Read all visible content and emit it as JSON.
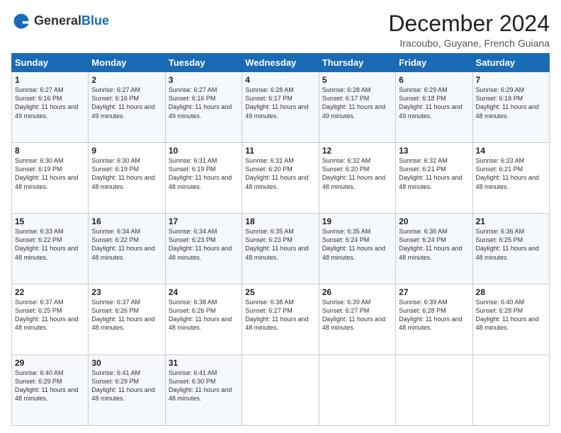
{
  "logo": {
    "general": "General",
    "blue": "Blue"
  },
  "title": "December 2024",
  "subtitle": "Iracoubo, Guyane, French Guiana",
  "days_header": [
    "Sunday",
    "Monday",
    "Tuesday",
    "Wednesday",
    "Thursday",
    "Friday",
    "Saturday"
  ],
  "weeks": [
    [
      {
        "day": "1",
        "sunrise": "6:27 AM",
        "sunset": "6:16 PM",
        "daylight": "11 hours and 49 minutes."
      },
      {
        "day": "2",
        "sunrise": "6:27 AM",
        "sunset": "6:16 PM",
        "daylight": "11 hours and 49 minutes."
      },
      {
        "day": "3",
        "sunrise": "6:27 AM",
        "sunset": "6:16 PM",
        "daylight": "11 hours and 49 minutes."
      },
      {
        "day": "4",
        "sunrise": "6:28 AM",
        "sunset": "6:17 PM",
        "daylight": "11 hours and 49 minutes."
      },
      {
        "day": "5",
        "sunrise": "6:28 AM",
        "sunset": "6:17 PM",
        "daylight": "11 hours and 49 minutes."
      },
      {
        "day": "6",
        "sunrise": "6:29 AM",
        "sunset": "6:18 PM",
        "daylight": "11 hours and 49 minutes."
      },
      {
        "day": "7",
        "sunrise": "6:29 AM",
        "sunset": "6:18 PM",
        "daylight": "11 hours and 48 minutes."
      }
    ],
    [
      {
        "day": "8",
        "sunrise": "6:30 AM",
        "sunset": "6:19 PM",
        "daylight": "11 hours and 48 minutes."
      },
      {
        "day": "9",
        "sunrise": "6:30 AM",
        "sunset": "6:19 PM",
        "daylight": "11 hours and 48 minutes."
      },
      {
        "day": "10",
        "sunrise": "6:31 AM",
        "sunset": "6:19 PM",
        "daylight": "11 hours and 48 minutes."
      },
      {
        "day": "11",
        "sunrise": "6:31 AM",
        "sunset": "6:20 PM",
        "daylight": "11 hours and 48 minutes."
      },
      {
        "day": "12",
        "sunrise": "6:32 AM",
        "sunset": "6:20 PM",
        "daylight": "11 hours and 48 minutes."
      },
      {
        "day": "13",
        "sunrise": "6:32 AM",
        "sunset": "6:21 PM",
        "daylight": "11 hours and 48 minutes."
      },
      {
        "day": "14",
        "sunrise": "6:33 AM",
        "sunset": "6:21 PM",
        "daylight": "11 hours and 48 minutes."
      }
    ],
    [
      {
        "day": "15",
        "sunrise": "6:33 AM",
        "sunset": "6:22 PM",
        "daylight": "11 hours and 48 minutes."
      },
      {
        "day": "16",
        "sunrise": "6:34 AM",
        "sunset": "6:22 PM",
        "daylight": "11 hours and 48 minutes."
      },
      {
        "day": "17",
        "sunrise": "6:34 AM",
        "sunset": "6:23 PM",
        "daylight": "11 hours and 48 minutes."
      },
      {
        "day": "18",
        "sunrise": "6:35 AM",
        "sunset": "6:23 PM",
        "daylight": "11 hours and 48 minutes."
      },
      {
        "day": "19",
        "sunrise": "6:35 AM",
        "sunset": "6:24 PM",
        "daylight": "11 hours and 48 minutes."
      },
      {
        "day": "20",
        "sunrise": "6:36 AM",
        "sunset": "6:24 PM",
        "daylight": "11 hours and 48 minutes."
      },
      {
        "day": "21",
        "sunrise": "6:36 AM",
        "sunset": "6:25 PM",
        "daylight": "11 hours and 48 minutes."
      }
    ],
    [
      {
        "day": "22",
        "sunrise": "6:37 AM",
        "sunset": "6:25 PM",
        "daylight": "11 hours and 48 minutes."
      },
      {
        "day": "23",
        "sunrise": "6:37 AM",
        "sunset": "6:26 PM",
        "daylight": "11 hours and 48 minutes."
      },
      {
        "day": "24",
        "sunrise": "6:38 AM",
        "sunset": "6:26 PM",
        "daylight": "11 hours and 48 minutes."
      },
      {
        "day": "25",
        "sunrise": "6:38 AM",
        "sunset": "6:27 PM",
        "daylight": "11 hours and 48 minutes."
      },
      {
        "day": "26",
        "sunrise": "6:39 AM",
        "sunset": "6:27 PM",
        "daylight": "11 hours and 48 minutes."
      },
      {
        "day": "27",
        "sunrise": "6:39 AM",
        "sunset": "6:28 PM",
        "daylight": "11 hours and 48 minutes."
      },
      {
        "day": "28",
        "sunrise": "6:40 AM",
        "sunset": "6:28 PM",
        "daylight": "11 hours and 48 minutes."
      }
    ],
    [
      {
        "day": "29",
        "sunrise": "6:40 AM",
        "sunset": "6:29 PM",
        "daylight": "11 hours and 48 minutes."
      },
      {
        "day": "30",
        "sunrise": "6:41 AM",
        "sunset": "6:29 PM",
        "daylight": "11 hours and 48 minutes."
      },
      {
        "day": "31",
        "sunrise": "6:41 AM",
        "sunset": "6:30 PM",
        "daylight": "11 hours and 48 minutes."
      },
      null,
      null,
      null,
      null
    ]
  ]
}
